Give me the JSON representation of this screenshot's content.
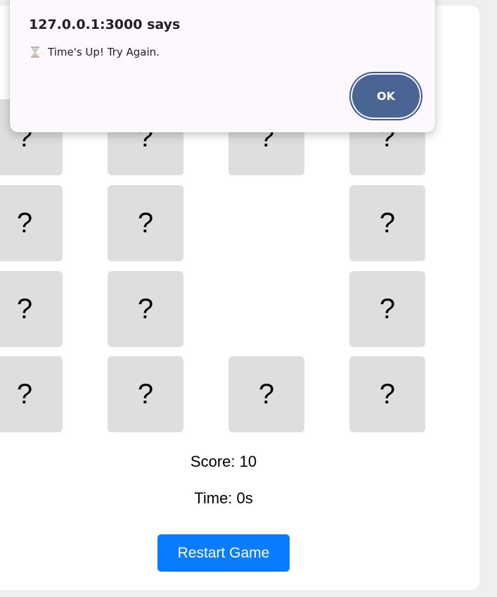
{
  "alert": {
    "title": "127.0.0.1:3000 says",
    "icon": "hourglass-icon",
    "message": "Time's Up! Try Again.",
    "ok_label": "OK"
  },
  "board": {
    "rows": [
      [
        "?",
        "?",
        "?",
        "?"
      ],
      [
        "?",
        "?",
        "",
        "?"
      ],
      [
        "?",
        "?",
        "",
        "?"
      ],
      [
        "?",
        "?",
        "?",
        "?"
      ]
    ]
  },
  "stats": {
    "score": "Score: 10",
    "time": "Time: 0s"
  },
  "restart_label": "Restart Game",
  "colors": {
    "accent": "#0a7cff",
    "card": "#dedede",
    "dialog_button": "#4a6494"
  }
}
